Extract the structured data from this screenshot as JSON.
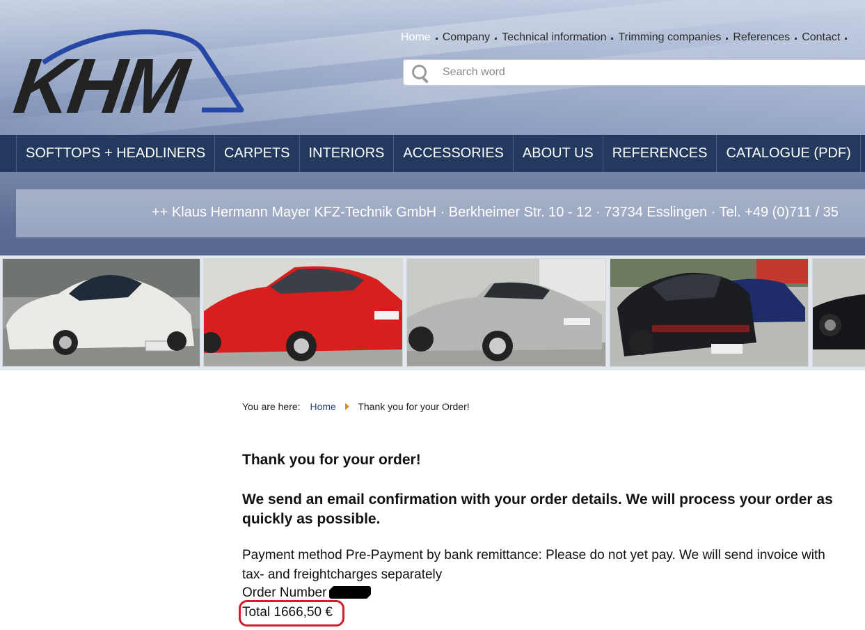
{
  "logo": {
    "text": "KHM"
  },
  "topnav": {
    "items": [
      {
        "label": "Home",
        "active": true
      },
      {
        "label": "Company"
      },
      {
        "label": "Technical information"
      },
      {
        "label": "Trimming companies"
      },
      {
        "label": "References"
      },
      {
        "label": "Contact"
      }
    ]
  },
  "search": {
    "placeholder": "Search word",
    "icon": "search-icon"
  },
  "mainnav": {
    "items": [
      "SOFTTOPS + HEADLINERS",
      "CARPETS",
      "INTERIORS",
      "ACCESSORIES",
      "ABOUT US",
      "REFERENCES",
      "CATALOGUE (PDF)"
    ]
  },
  "ticker": {
    "text": "++  Klaus Hermann Mayer KFZ-Technik GmbH  ·  Berkheimer Str. 10 - 12  ·  73734 Esslingen  ·  Tel. +49 (0)711 / 35"
  },
  "breadcrumb": {
    "label": "You are here:",
    "home": "Home",
    "current": "Thank you for your Order!"
  },
  "content": {
    "heading": "Thank you for your order!",
    "subheading": "We send an email confirmation with your order details. We will process your order as quickly as possible.",
    "payment": "Payment method Pre-Payment by bank remittance: Please do not yet pay. We will send invoice with tax- and freightcharges separately",
    "order_number_label": "Order Number",
    "total": "Total 1666,50 €"
  },
  "colors": {
    "nav_bg": "#233a5e",
    "highlight": "#d21c2a",
    "breadcrumb_arrow": "#e08a1e"
  }
}
